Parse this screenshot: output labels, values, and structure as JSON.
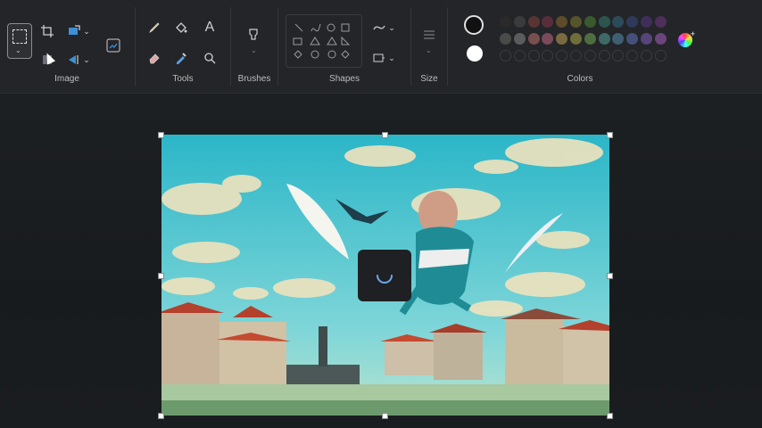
{
  "ribbon": {
    "image_label": "Image",
    "tools_label": "Tools",
    "brushes_label": "Brushes",
    "shapes_label": "Shapes",
    "size_label": "Size",
    "colors_label": "Colors"
  },
  "tools": {
    "text_glyph": "A"
  },
  "colors": {
    "primary": "#111111",
    "secondary": "#ffffff",
    "row1": [
      "#2a2a2a",
      "#3b3b3b",
      "#5a3434",
      "#5a2d3a",
      "#5e4b2a",
      "#55542a",
      "#3a5a2d",
      "#2d5550",
      "#2d4a5a",
      "#2f3a5a",
      "#3e2f5a",
      "#4e2f5a"
    ],
    "row2": [
      "#4a4a4a",
      "#5c5c5c",
      "#7a4e4e",
      "#7a4a5a",
      "#7a6a40",
      "#6e6e3a",
      "#4e6e40",
      "#3e6a66",
      "#3e5e72",
      "#44507a",
      "#56447a",
      "#6a447a"
    ]
  },
  "canvas": {
    "loading": true
  }
}
